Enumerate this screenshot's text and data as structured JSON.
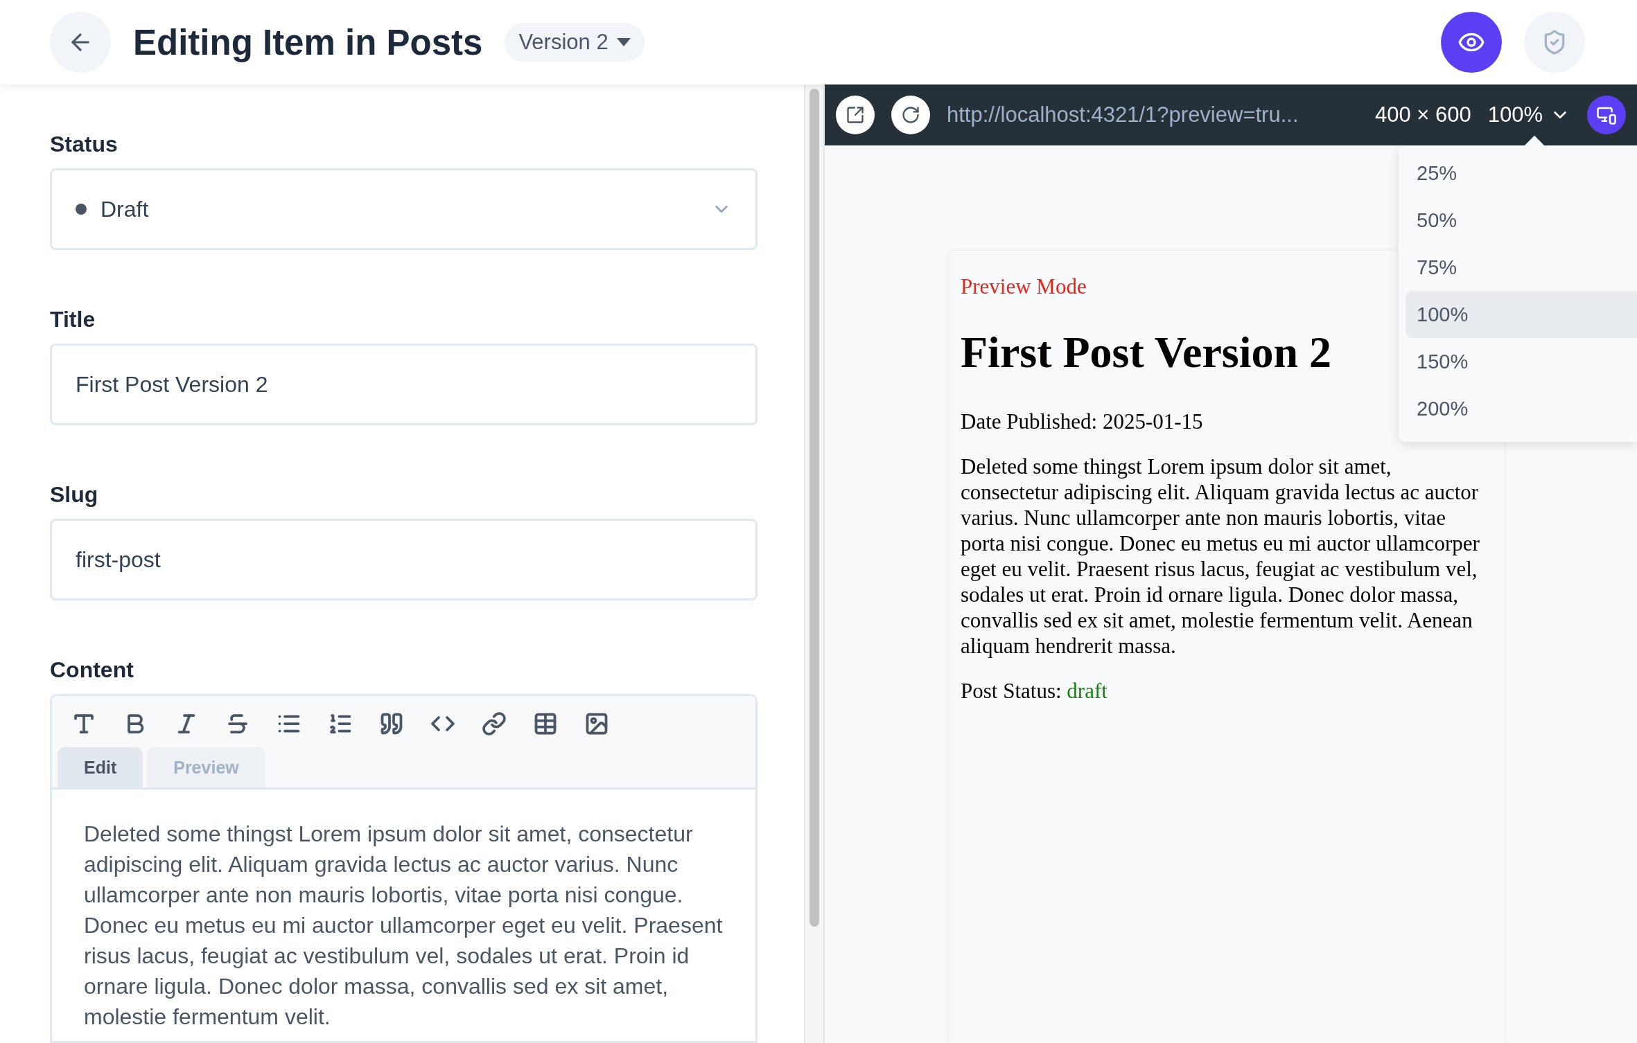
{
  "header": {
    "title": "Editing Item in Posts",
    "version": "Version 2",
    "preview_on": true
  },
  "form": {
    "status": {
      "label": "Status",
      "value": "Draft"
    },
    "title": {
      "label": "Title",
      "value": "First Post Version 2"
    },
    "slug": {
      "label": "Slug",
      "value": "first-post"
    },
    "content": {
      "label": "Content",
      "tabs": [
        {
          "label": "Edit",
          "selected": true
        },
        {
          "label": "Preview",
          "selected": false
        }
      ],
      "text": "Deleted some thingst Lorem ipsum dolor sit amet, consectetur adipiscing elit. Aliquam gravida lectus ac auctor varius. Nunc ullamcorper ante non mauris lobortis, vitae porta nisi congue. Donec eu metus eu mi auctor ullamcorper eget eu velit. Praesent risus lacus, feugiat ac vestibulum vel, sodales ut erat. Proin id ornare ligula. Donec dolor massa, convallis sed ex sit amet, molestie fermentum velit."
    }
  },
  "preview_bar": {
    "url": "http://localhost:4321/1?preview=tru...",
    "size": "400 × 600",
    "zoom": "100%",
    "zoom_options": [
      {
        "label": "25%",
        "selected": false
      },
      {
        "label": "50%",
        "selected": false
      },
      {
        "label": "75%",
        "selected": false
      },
      {
        "label": "100%",
        "selected": true
      },
      {
        "label": "150%",
        "selected": false
      },
      {
        "label": "200%",
        "selected": false
      }
    ]
  },
  "preview_page": {
    "mode": "Preview Mode",
    "heading": "First Post Version 2",
    "date": "Date Published: 2025-01-15",
    "body": "Deleted some thingst Lorem ipsum dolor sit amet, consectetur adipiscing elit. Aliquam gravida lectus ac auctor varius. Nunc ullamcorper ante non mauris lobortis, vitae porta nisi congue. Donec eu metus eu mi auctor ullamcorper eget eu velit. Praesent risus lacus, feugiat ac vestibulum vel, sodales ut erat. Proin id ornare ligula. Donec dolor massa, convallis sed ex sit amet, molestie fermentum velit. Aenean aliquam hendrerit massa.",
    "status_label": "Post Status:",
    "status_value": "draft"
  }
}
